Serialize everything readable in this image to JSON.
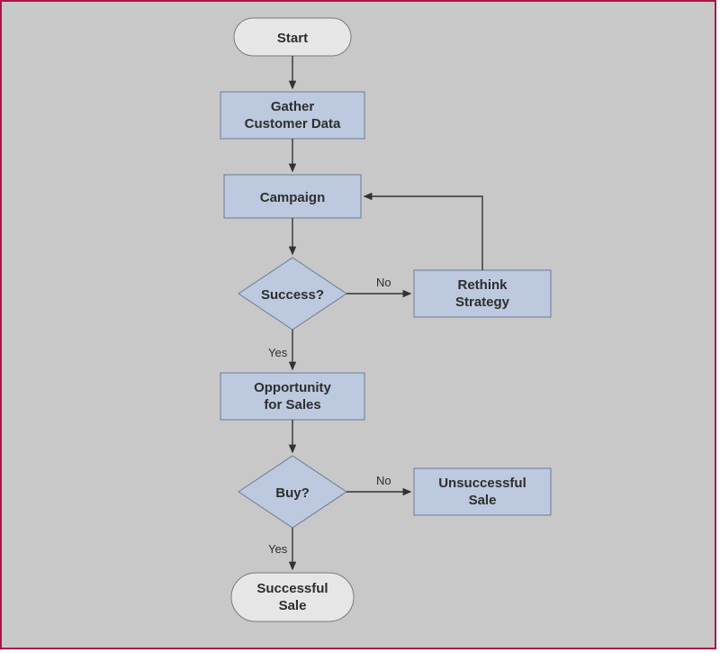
{
  "diagram": {
    "nodes": {
      "start": "Start",
      "gather_l1": "Gather",
      "gather_l2": "Customer Data",
      "campaign": "Campaign",
      "success_q": "Success?",
      "rethink_l1": "Rethink",
      "rethink_l2": "Strategy",
      "opportunity_l1": "Opportunity",
      "opportunity_l2": "for Sales",
      "buy_q": "Buy?",
      "unsuccessful_l1": "Unsuccessful",
      "unsuccessful_l2": "Sale",
      "successful_l1": "Successful",
      "successful_l2": "Sale"
    },
    "labels": {
      "no": "No",
      "yes": "Yes"
    }
  },
  "chart_data": {
    "type": "flowchart",
    "title": "",
    "nodes": [
      {
        "id": "start",
        "type": "terminator",
        "label": "Start"
      },
      {
        "id": "gather",
        "type": "process",
        "label": "Gather Customer Data"
      },
      {
        "id": "campaign",
        "type": "process",
        "label": "Campaign"
      },
      {
        "id": "success",
        "type": "decision",
        "label": "Success?"
      },
      {
        "id": "rethink",
        "type": "process",
        "label": "Rethink Strategy"
      },
      {
        "id": "opportunity",
        "type": "process",
        "label": "Opportunity for Sales"
      },
      {
        "id": "buy",
        "type": "decision",
        "label": "Buy?"
      },
      {
        "id": "unsuccessful",
        "type": "process",
        "label": "Unsuccessful Sale"
      },
      {
        "id": "successful",
        "type": "terminator",
        "label": "Successful Sale"
      }
    ],
    "edges": [
      {
        "from": "start",
        "to": "gather",
        "label": ""
      },
      {
        "from": "gather",
        "to": "campaign",
        "label": ""
      },
      {
        "from": "campaign",
        "to": "success",
        "label": ""
      },
      {
        "from": "success",
        "to": "rethink",
        "label": "No"
      },
      {
        "from": "rethink",
        "to": "campaign",
        "label": ""
      },
      {
        "from": "success",
        "to": "opportunity",
        "label": "Yes"
      },
      {
        "from": "opportunity",
        "to": "buy",
        "label": ""
      },
      {
        "from": "buy",
        "to": "unsuccessful",
        "label": "No"
      },
      {
        "from": "buy",
        "to": "successful",
        "label": "Yes"
      }
    ]
  }
}
